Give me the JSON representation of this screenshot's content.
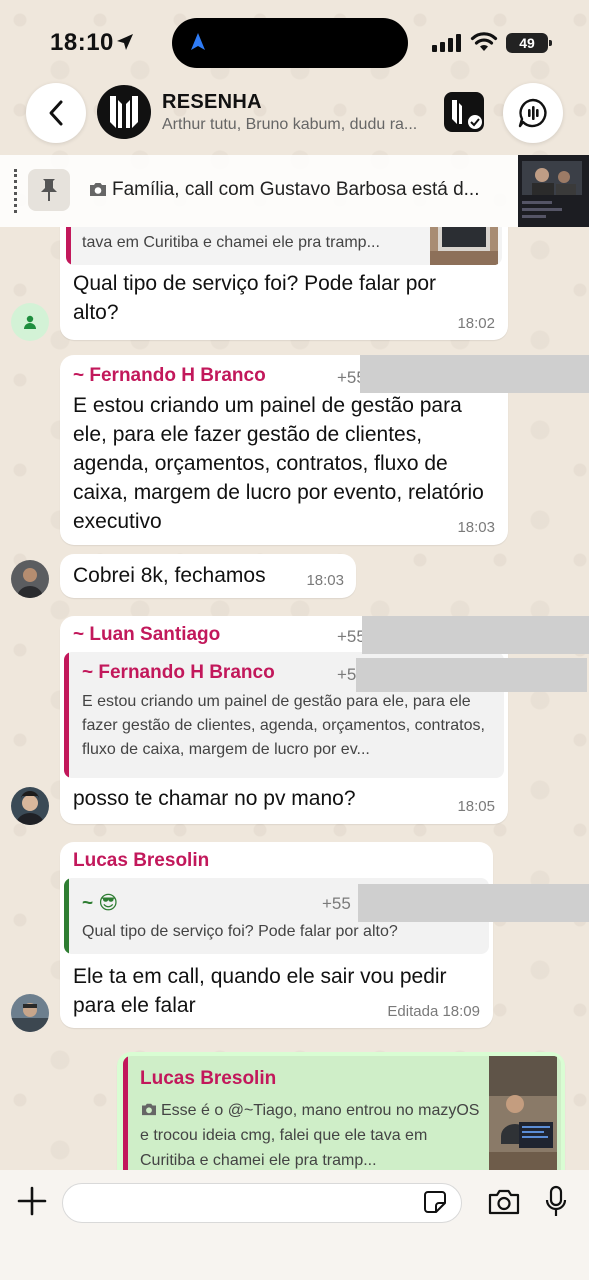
{
  "status_bar": {
    "time": "18:10",
    "battery": "49"
  },
  "header": {
    "group_name": "RESENHA",
    "members": "Arthur tutu, Bruno kabum, dudu ra..."
  },
  "pinned": {
    "text": "Família, call com Gustavo Barbosa está d..."
  },
  "messages": {
    "m1": {
      "quote_text": "tava em Curitiba e chamei ele pra tramp...",
      "text": "Qual tipo de serviço foi? Pode falar por alto?",
      "time": "18:02"
    },
    "m2": {
      "sender": "~ Fernando H Branco",
      "phone": "+55",
      "text": "E estou criando um painel de gestão para ele, para ele fazer gestão de clientes, agenda, orçamentos, contratos, fluxo de caixa, margem de lucro por evento, relatório executivo",
      "time": "18:03"
    },
    "m3": {
      "text": "Cobrei 8k, fechamos",
      "time": "18:03"
    },
    "m4": {
      "sender": "~ Luan Santiago",
      "phone": "+55",
      "quote_sender": "~ Fernando H Branco",
      "quote_phone": "+5",
      "quote_text": "E estou criando um painel de gestão para ele, para ele fazer gestão de clientes, agenda, orçamentos, contratos, fluxo de caixa, margem de lucro por ev...",
      "text": "posso te chamar no pv mano?",
      "time": "18:05"
    },
    "m5": {
      "sender": "Lucas Bresolin",
      "quote_sender": "~ 😎",
      "quote_phone": "+55",
      "quote_text": "Qual tipo de serviço foi? Pode falar por alto?",
      "text": "Ele ta em call, quando ele sair vou pedir para ele falar",
      "edited": "Editada",
      "time": "18:09"
    },
    "m6": {
      "quote_sender": "Lucas Bresolin",
      "quote_text": "Esse é o @~Tiago, mano entrou no mazyOS e trocou ideia cmg, falei que ele tava em Curitiba e chamei ele pra tramp..."
    }
  },
  "colors": {
    "fernando": "#c2185b",
    "luan": "#c2185b",
    "lucas": "#c2185b",
    "emoji_sender": "#2e7d32",
    "own_bubble": "#d9fdd3"
  }
}
